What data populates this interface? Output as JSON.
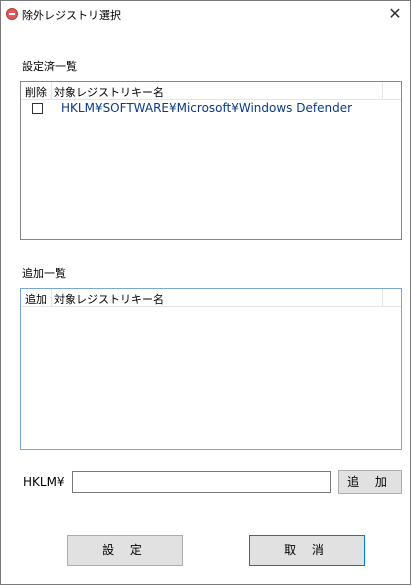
{
  "window": {
    "title": "除外レジストリ選択",
    "close_glyph": "✕"
  },
  "configured": {
    "section_label": "設定済一覧",
    "columns": [
      "削除",
      "対象レジストリキー名"
    ],
    "rows": [
      {
        "checked": false,
        "key": "HKLM¥SOFTWARE¥Microsoft¥Windows Defender"
      }
    ]
  },
  "additions": {
    "section_label": "追加一覧",
    "columns": [
      "追加",
      "対象レジストリキー名"
    ],
    "rows": []
  },
  "input": {
    "prefix": "HKLM¥",
    "value": "",
    "add_label": "追 加"
  },
  "actions": {
    "set_label": "設 定",
    "cancel_label": "取 消"
  },
  "colors": {
    "link_text": "#0b3a8a",
    "focus_border": "#0078d7"
  }
}
